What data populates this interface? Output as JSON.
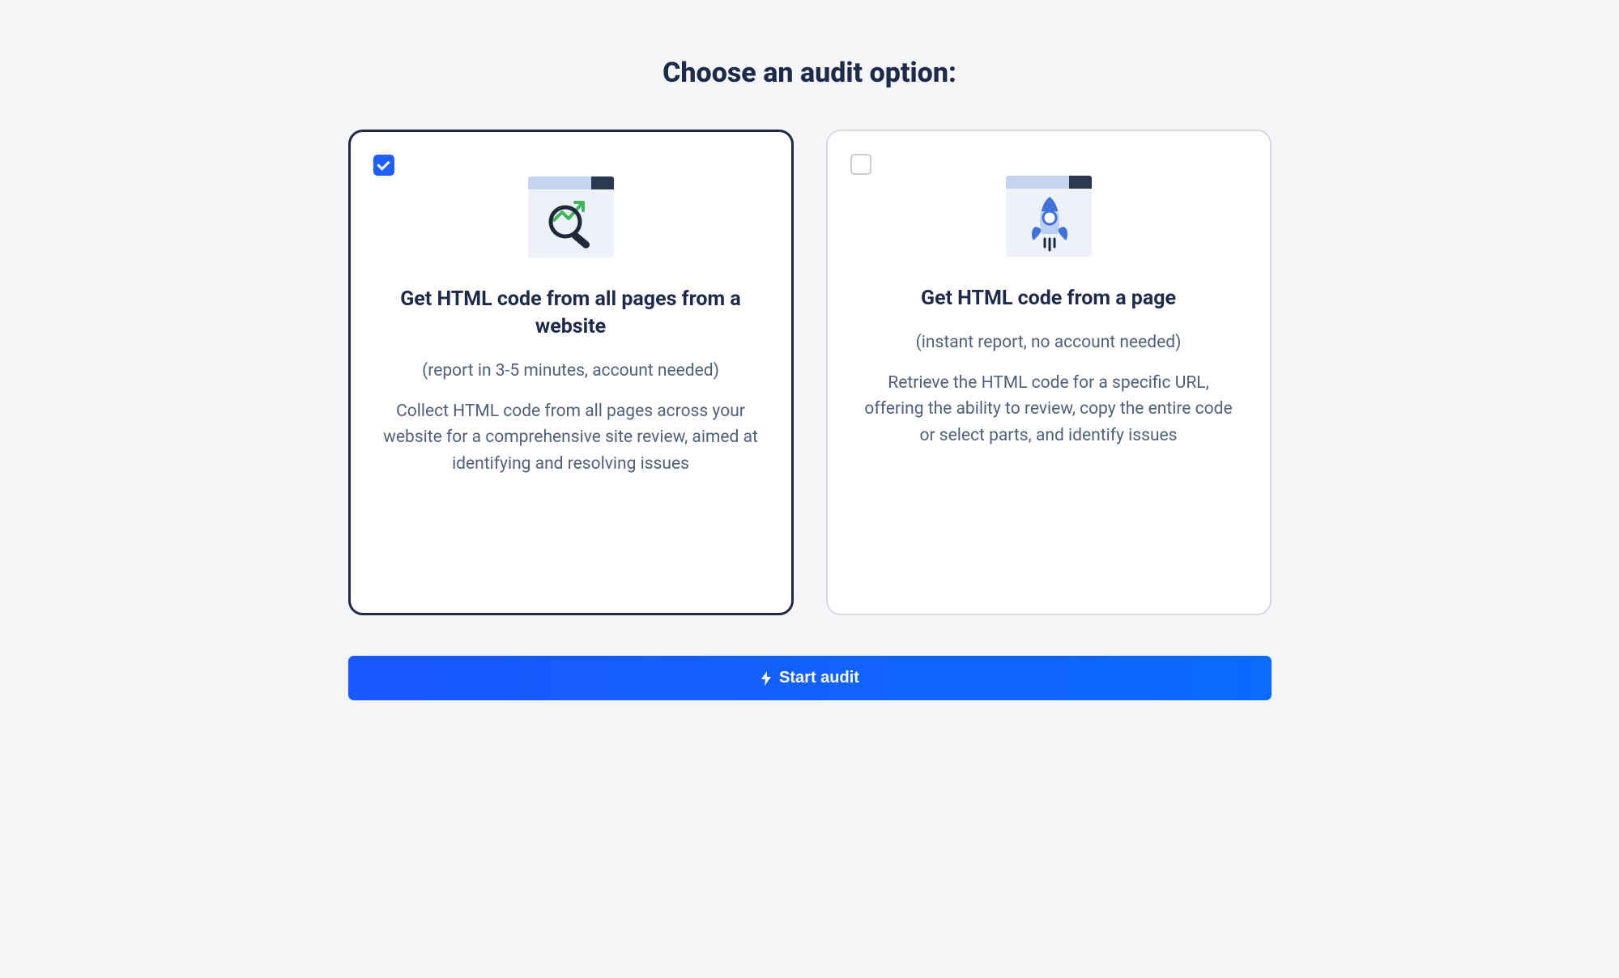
{
  "page": {
    "title": "Choose an audit option:"
  },
  "options": [
    {
      "title": "Get HTML code from all pages from a website",
      "subtitle": "(report in 3-5 minutes, account needed)",
      "description": "Collect HTML code from all pages across your website for a comprehensive site review, aimed at identifying and resolving issues",
      "selected": true
    },
    {
      "title": "Get HTML code from a page",
      "subtitle": "(instant report, no account needed)",
      "description": "Retrieve the HTML code for a specific URL, offering the ability to review, copy the entire code or select parts, and identify issues",
      "selected": false
    }
  ],
  "actions": {
    "start_label": "Start audit"
  }
}
